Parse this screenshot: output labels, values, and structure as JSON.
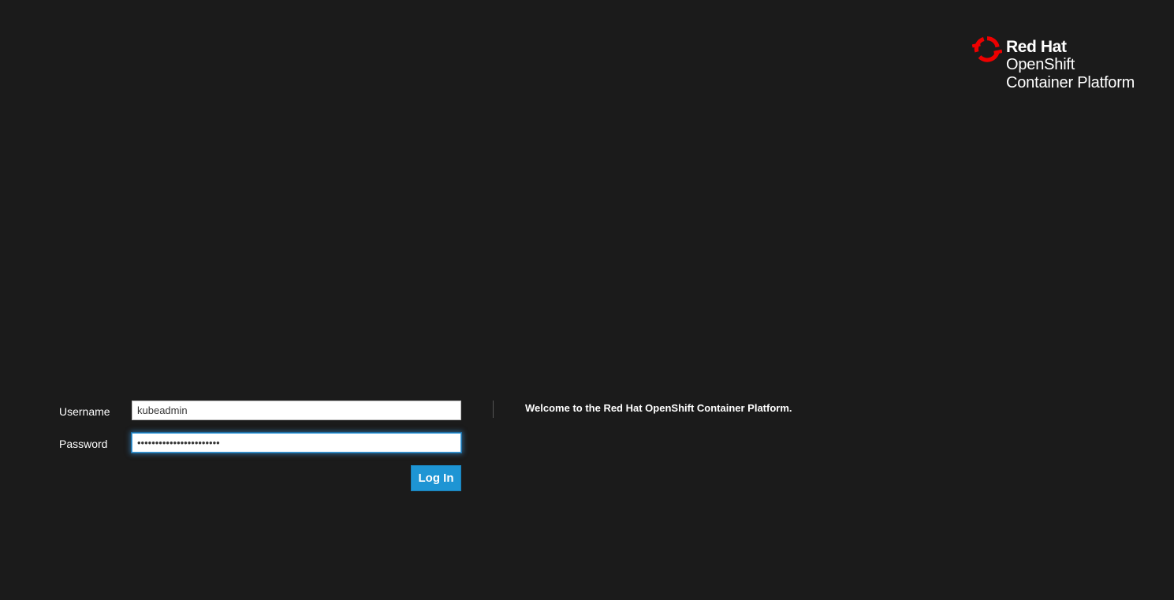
{
  "brand": {
    "line1": "Red Hat",
    "line2": "OpenShift",
    "line3": "Container Platform",
    "icon": "red-hat-openshift-logo-icon",
    "accent_color": "#ee0000"
  },
  "login_form": {
    "username_label": "Username",
    "username_value": "kubeadmin",
    "password_label": "Password",
    "password_value": "•••••••••••••••••••••••",
    "submit_label": "Log In",
    "button_color": "#1e95d4"
  },
  "welcome_message": "Welcome to the Red Hat OpenShift Container Platform."
}
